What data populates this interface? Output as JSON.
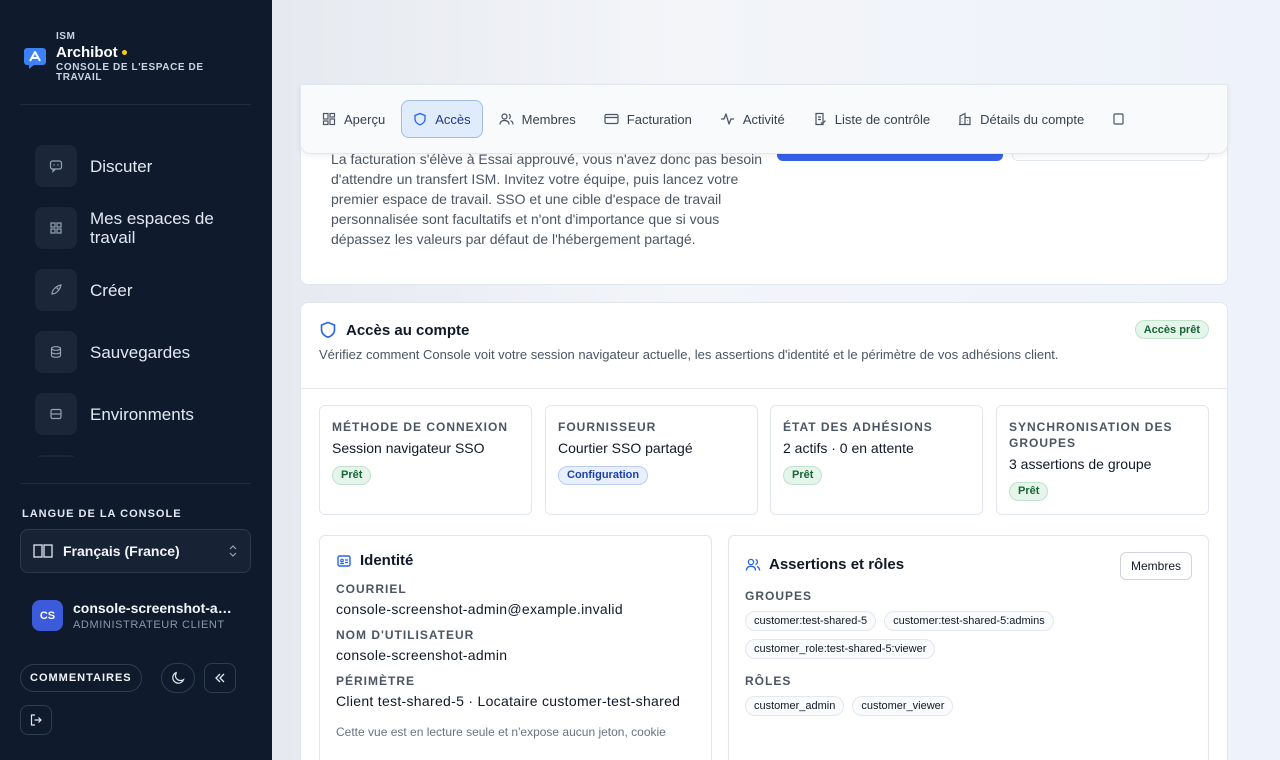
{
  "sidebar": {
    "org": "ISM",
    "app_name": "Archibot",
    "subtitle": "CONSOLE DE L'ESPACE DE TRAVAIL",
    "nav": [
      {
        "label": "Discuter",
        "icon": "chat-icon"
      },
      {
        "label": "Mes espaces de travail",
        "icon": "grid-icon"
      },
      {
        "label": "Créer",
        "icon": "rocket-icon"
      },
      {
        "label": "Sauvegardes",
        "icon": "database-icon"
      },
      {
        "label": "Environments",
        "icon": "server-icon"
      }
    ],
    "language_title": "LANGUE DE LA CONSOLE",
    "language_value": "Français (France)",
    "user_initials": "CS",
    "user_name": "console-screenshot-admin",
    "user_role": "ADMINISTRATEUR CLIENT",
    "feedback_label": "COMMENTAIRES"
  },
  "tabs": [
    {
      "label": "Aperçu",
      "icon": "grid-icon",
      "active": false
    },
    {
      "label": "Accès",
      "icon": "shield-icon",
      "active": true
    },
    {
      "label": "Membres",
      "icon": "users-icon",
      "active": false
    },
    {
      "label": "Facturation",
      "icon": "card-icon",
      "active": false
    },
    {
      "label": "Activité",
      "icon": "activity-icon",
      "active": false
    },
    {
      "label": "Liste de contrôle",
      "icon": "checklist-icon",
      "active": false
    },
    {
      "label": "Détails du compte",
      "icon": "building-icon",
      "active": false
    }
  ],
  "intro": {
    "text": "La facturation s'élève à Essai approuvé, vous n'avez donc pas besoin d'attendre un transfert ISM. Invitez votre équipe, puis lancez votre premier espace de travail. SSO et une cible d'espace de travail personnalisée sont facultatifs et n'ont d'importance que si vous dépassez les valeurs par défaut de l'hébergement partagé."
  },
  "access": {
    "title": "Accès au compte",
    "status": "Accès prêt",
    "description": "Vérifiez comment Console voit votre session navigateur actuelle, les assertions d'identité et le périmètre de vos adhésions client.",
    "stats": [
      {
        "label": "MÉTHODE DE CONNEXION",
        "value": "Session navigateur SSO",
        "badge": "Prêt",
        "badge_kind": "green"
      },
      {
        "label": "FOURNISSEUR",
        "value": "Courtier SSO partagé",
        "badge": "Configuration",
        "badge_kind": "blue"
      },
      {
        "label": "ÉTAT DES ADHÉSIONS",
        "value": "2 actifs · 0 en attente",
        "badge": "Prêt",
        "badge_kind": "green"
      },
      {
        "label": "SYNCHRONISATION DES GROUPES",
        "value": "3 assertions de groupe",
        "badge": "Prêt",
        "badge_kind": "green"
      }
    ],
    "identity": {
      "title": "Identité",
      "email_label": "COURRIEL",
      "email": "console-screenshot-admin@example.invalid",
      "username_label": "NOM D'UTILISATEUR",
      "username": "console-screenshot-admin",
      "scope_label": "PÉRIMÈTRE",
      "scope": "Client test-shared-5 · Locataire customer-test-shared",
      "note": "Cette vue est en lecture seule et n'expose aucun jeton, cookie"
    },
    "roles": {
      "title": "Assertions et rôles",
      "members_button": "Membres",
      "groups_label": "GROUPES",
      "groups": [
        "customer:test-shared-5",
        "customer:test-shared-5:admins",
        "customer_role:test-shared-5:viewer"
      ],
      "roles_label": "RÔLES",
      "roles": [
        "customer_admin",
        "customer_viewer"
      ]
    }
  },
  "colors": {
    "sidebar_bg": "#0f1b2d",
    "accent": "#3560e8",
    "ready_green": "#166534",
    "active_tab_bg": "#e0ebfb"
  }
}
